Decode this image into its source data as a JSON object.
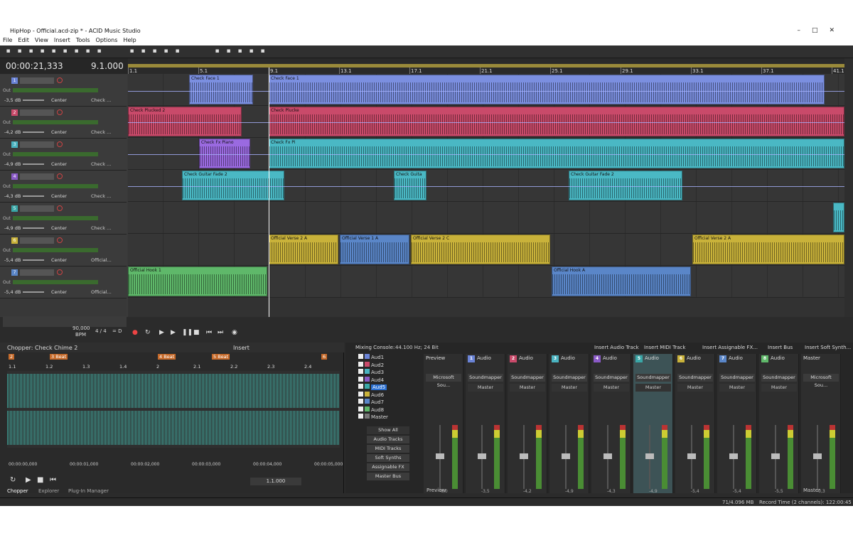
{
  "window": {
    "title": "HipHop - Official.acd-zip * - ACID Music Studio",
    "controls": [
      "–",
      "□",
      "✕"
    ]
  },
  "menu": [
    "File",
    "Edit",
    "View",
    "Insert",
    "Tools",
    "Options",
    "Help"
  ],
  "time": {
    "position": "00:00:21,333",
    "measure": "9.1.000"
  },
  "ruler": [
    "1.1",
    "5.1",
    "9.1",
    "13.1",
    "17.1",
    "21.1",
    "25.1",
    "29.1",
    "33.1",
    "37.1",
    "41.1"
  ],
  "tracks": [
    {
      "num": "1",
      "color": "#6a83d6",
      "db": "-3,5 dB",
      "pan": "Center",
      "name": "Check ..."
    },
    {
      "num": "2",
      "color": "#c94a6a",
      "db": "-4,2 dB",
      "pan": "Center",
      "name": "Check ..."
    },
    {
      "num": "3",
      "color": "#4ab3c0",
      "db": "-4,9 dB",
      "pan": "Center",
      "name": "Check ..."
    },
    {
      "num": "4",
      "color": "#8a5ac6",
      "db": "-4,3 dB",
      "pan": "Center",
      "name": "Check ..."
    },
    {
      "num": "5",
      "color": "#3aa7a7",
      "db": "-4,9 dB",
      "pan": "Center",
      "name": "Check ..."
    },
    {
      "num": "6",
      "color": "#c9b23a",
      "db": "-5,4 dB",
      "pan": "Center",
      "name": "Official..."
    },
    {
      "num": "7",
      "color": "#5a86c8",
      "db": "-5,4 dB",
      "pan": "Center",
      "name": "Official..."
    }
  ],
  "clips": [
    {
      "lane": 0,
      "from": 86,
      "to": 176,
      "color": "#7b8fe0",
      "label": "Check Face 1"
    },
    {
      "lane": 0,
      "from": 198,
      "to": 980,
      "color": "#7b8fe0",
      "label": "Check Face 1"
    },
    {
      "lane": 1,
      "from": 0,
      "to": 160,
      "color": "#c94a6a",
      "label": "Check Plucked 2"
    },
    {
      "lane": 1,
      "from": 198,
      "to": 1008,
      "color": "#c94a6a",
      "label": "Check Plucke"
    },
    {
      "lane": 2,
      "from": 100,
      "to": 172,
      "color": "#9a6ae0",
      "label": "Check Fx Piano"
    },
    {
      "lane": 2,
      "from": 198,
      "to": 1008,
      "color": "#4ab8c4",
      "label": "Check Fx Pi"
    },
    {
      "lane": 3,
      "from": 76,
      "to": 220,
      "color": "#4ab8c4",
      "label": "Check Guitar Fade 2"
    },
    {
      "lane": 3,
      "from": 374,
      "to": 420,
      "color": "#4ab8c4",
      "label": "Check Guita"
    },
    {
      "lane": 3,
      "from": 620,
      "to": 780,
      "color": "#4ab8c4",
      "label": "Check Guitar Fade 2"
    },
    {
      "lane": 4,
      "from": 992,
      "to": 1008,
      "color": "#4ab8c4",
      "label": ""
    },
    {
      "lane": 5,
      "from": 198,
      "to": 296,
      "color": "#c9b23a",
      "label": "Official Verse 2 A"
    },
    {
      "lane": 5,
      "from": 298,
      "to": 396,
      "color": "#5a86c8",
      "label": "Official Verse 1 A"
    },
    {
      "lane": 5,
      "from": 398,
      "to": 594,
      "color": "#c9b23a",
      "label": "Official Verse 2 C"
    },
    {
      "lane": 5,
      "from": 794,
      "to": 1008,
      "color": "#c9b23a",
      "label": "Official Verse 2 A"
    },
    {
      "lane": 6,
      "from": 0,
      "to": 196,
      "color": "#5fb86a",
      "label": "Official Hook 1"
    },
    {
      "lane": 6,
      "from": 596,
      "to": 792,
      "color": "#5a86c8",
      "label": "Official Hook A"
    }
  ],
  "transport": {
    "bpm": "90,000",
    "bpm_label": "BPM",
    "sig": "4 / 4",
    "eq": "= D"
  },
  "chopper": {
    "title": "Chopper: Check Chime 2",
    "insert": "Insert",
    "markers": [
      "2",
      "3 Beat",
      "4 Beat",
      "5 Beat",
      "6"
    ],
    "ticks": [
      "1.1",
      "1.2",
      "1.3",
      "1.4",
      "2",
      "2.1",
      "2.2",
      "2.3",
      "2.4"
    ],
    "times": [
      "00:00:00,000",
      "00:00:01,000",
      "00:00:02,000",
      "00:00:03,000",
      "00:00:04,000",
      "00:00:05,000"
    ],
    "position": "1.1.000",
    "tabs": [
      "Chopper",
      "Explorer",
      "Plug-In Manager"
    ]
  },
  "mixer": {
    "title": "Mixing Console:",
    "info": "44.100 Hz; 24 Bit",
    "buttons": [
      "Insert Audio Track",
      "Insert MIDI Track",
      "Insert Assignable FX...",
      "Insert Bus",
      "Insert Soft Synth..."
    ],
    "list": [
      "Aud1",
      "Aud2",
      "Aud3",
      "Aud4",
      "Aud5",
      "Aud6",
      "Aud7",
      "Aud8",
      "Master"
    ],
    "filters": [
      "Show All",
      "Audio Tracks",
      "MIDI Tracks",
      "Soft Synths",
      "Assignable FX",
      "Master Bus"
    ],
    "channels": [
      {
        "num": "",
        "name": "Preview",
        "out": "Microsoft Sou...",
        "bus": "",
        "val": "-6,0",
        "color": "#555"
      },
      {
        "num": "1",
        "name": "Audio",
        "out": "Soundmapper",
        "bus": "Master",
        "val": "-3,5",
        "color": "#6a83d6"
      },
      {
        "num": "2",
        "name": "Audio",
        "out": "Soundmapper",
        "bus": "Master",
        "val": "-4,2",
        "color": "#c94a6a"
      },
      {
        "num": "3",
        "name": "Audio",
        "out": "Soundmapper",
        "bus": "Master",
        "val": "-4,9",
        "color": "#4ab3c0"
      },
      {
        "num": "4",
        "name": "Audio",
        "out": "Soundmapper",
        "bus": "Master",
        "val": "-4,3",
        "color": "#8a5ac6"
      },
      {
        "num": "5",
        "name": "Audio",
        "out": "Soundmapper",
        "bus": "Master",
        "val": "-4,9",
        "color": "#3aa7a7"
      },
      {
        "num": "6",
        "name": "Audio",
        "out": "Soundmapper",
        "bus": "Master",
        "val": "-5,4",
        "color": "#c9b23a"
      },
      {
        "num": "7",
        "name": "Audio",
        "out": "Soundmapper",
        "bus": "Master",
        "val": "-5,4",
        "color": "#5a86c8"
      },
      {
        "num": "8",
        "name": "Audio",
        "out": "Soundmapper",
        "bus": "Master",
        "val": "-5,5",
        "color": "#5fb86a"
      },
      {
        "num": "",
        "name": "Master",
        "out": "Microsoft Sou...",
        "bus": "",
        "val": "-0,3",
        "color": "#555"
      }
    ],
    "footer": [
      "Preview",
      "Master"
    ]
  },
  "status": {
    "mem": "71/4.096 MB",
    "record": "Record Time (2 channels): 122:00:45"
  }
}
